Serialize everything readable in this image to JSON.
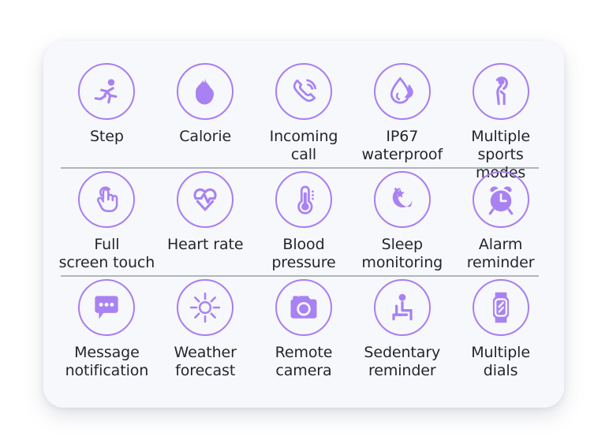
{
  "theme": {
    "page_background": "#ffffff",
    "card_background": "#f6f8fc",
    "accent_purple": "#a97ef0",
    "icon_fill": "#a882f2",
    "divider_color": "#9aa0a6",
    "label_color": "#23262b"
  },
  "card": {
    "rows": [
      {
        "tiles": [
          {
            "icon": "running-person-icon",
            "label": "Step"
          },
          {
            "icon": "flame-icon",
            "label": "Calorie"
          },
          {
            "icon": "incoming-call-icon",
            "label": "Incoming\ncall"
          },
          {
            "icon": "water-drop-icon",
            "label": "IP67\nwaterproof"
          },
          {
            "icon": "stretching-person-icon",
            "label": "Multiple\nsports modes"
          }
        ]
      },
      {
        "tiles": [
          {
            "icon": "hand-tap-icon",
            "label": "Full\nscreen touch"
          },
          {
            "icon": "heart-pulse-icon",
            "label": "Heart rate"
          },
          {
            "icon": "thermometer-icon",
            "label": "Blood\npressure"
          },
          {
            "icon": "moon-star-icon",
            "label": "Sleep\nmonitoring"
          },
          {
            "icon": "alarm-clock-icon",
            "label": "Alarm\nreminder"
          }
        ]
      },
      {
        "tiles": [
          {
            "icon": "message-bubble-icon",
            "label": "Message\nnotification"
          },
          {
            "icon": "sun-icon",
            "label": "Weather\nforecast"
          },
          {
            "icon": "camera-icon",
            "label": "Remote\ncamera"
          },
          {
            "icon": "sitting-person-icon",
            "label": "Sedentary\nreminder"
          },
          {
            "icon": "smartwatch-icon",
            "label": "Multiple\ndials"
          }
        ]
      }
    ],
    "dividers": 2
  }
}
